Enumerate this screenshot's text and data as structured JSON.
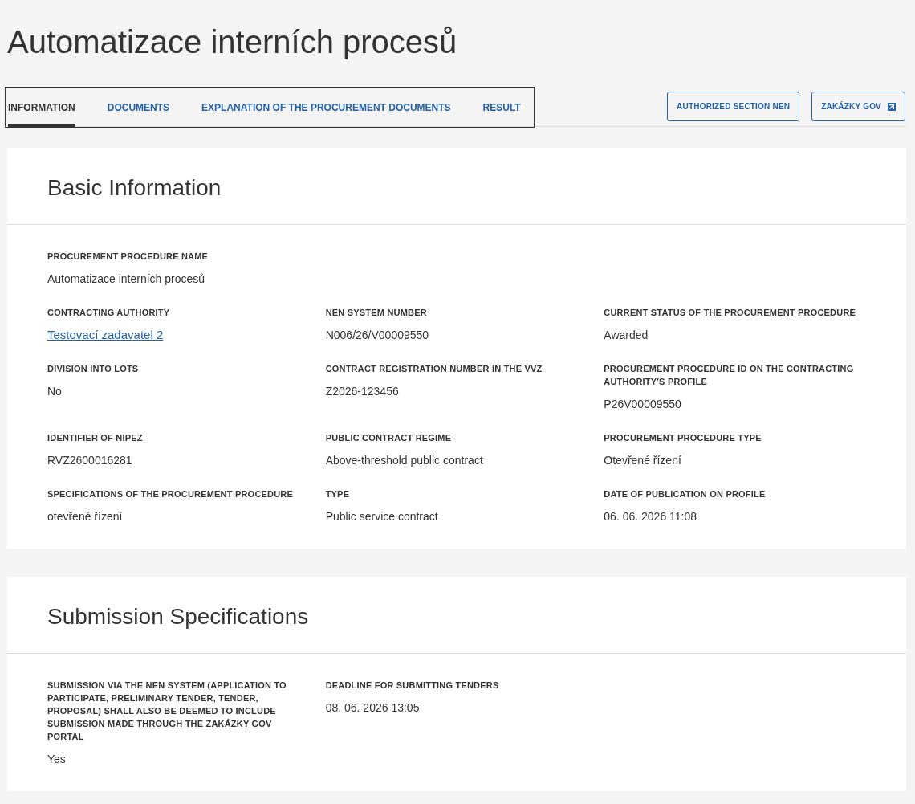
{
  "page_title": "Automatizace interních procesů",
  "tab_bar": {
    "focused": true,
    "tabs": [
      {
        "label": "INFORMATION",
        "selected": true
      },
      {
        "label": "DOCUMENTS",
        "selected": false
      },
      {
        "label": "EXPLANATION OF THE PROCUREMENT DOCUMENTS",
        "selected": false
      },
      {
        "label": "RESULT",
        "selected": false
      }
    ]
  },
  "actions": [
    {
      "label": "AUTHORIZED SECTION NEN",
      "external": false
    },
    {
      "label": "ZAKÁZKY GOV",
      "external": true
    }
  ],
  "sections": [
    {
      "title": "Basic Information",
      "rows": [
        [
          {
            "label": "PROCUREMENT PROCEDURE NAME",
            "value": "Automatizace interních procesů",
            "kind": "text"
          }
        ],
        [
          {
            "label": "CONTRACTING AUTHORITY",
            "value": "Testovací zadavatel 2",
            "kind": "link"
          },
          {
            "label": "NEN SYSTEM NUMBER",
            "value": "N006/26/V00009550",
            "kind": "text"
          },
          {
            "label": "CURRENT STATUS OF THE PROCUREMENT PROCEDURE",
            "value": "Awarded",
            "kind": "text"
          }
        ],
        [
          {
            "label": "DIVISION INTO LOTS",
            "value": "No",
            "kind": "text"
          },
          {
            "label": "CONTRACT REGISTRATION NUMBER IN THE VVZ",
            "value": "Z2026-123456",
            "kind": "text"
          },
          {
            "label": "PROCUREMENT PROCEDURE ID ON THE CONTRACTING AUTHORITY'S PROFILE",
            "value": "P26V00009550",
            "kind": "text"
          }
        ],
        [
          {
            "label": "IDENTIFIER OF NIPEZ",
            "value": "RVZ2600016281",
            "kind": "text"
          },
          {
            "label": "PUBLIC CONTRACT REGIME",
            "value": "Above-threshold public contract",
            "kind": "text"
          },
          {
            "label": "PROCUREMENT PROCEDURE TYPE",
            "value": "Otevřené řízení",
            "kind": "text"
          }
        ],
        [
          {
            "label": "SPECIFICATIONS OF THE PROCUREMENT PROCEDURE",
            "value": "otevřené řízení",
            "kind": "text"
          },
          {
            "label": "TYPE",
            "value": "Public service contract",
            "kind": "text"
          },
          {
            "label": "DATE OF PUBLICATION ON PROFILE",
            "value": "06. 06. 2026 11:08",
            "kind": "text"
          }
        ]
      ]
    },
    {
      "title": "Submission Specifications",
      "rows": [
        [
          {
            "label": "SUBMISSION VIA THE NEN SYSTEM (APPLICATION TO PARTICIPATE, PRELIMINARY TENDER, TENDER, PROPOSAL) SHALL ALSO BE DEEMED TO INCLUDE SUBMISSION MADE THROUGH THE ZAKÁZKY GOV PORTAL",
            "value": "Yes",
            "kind": "text"
          },
          {
            "label": "DEADLINE FOR SUBMITTING TENDERS",
            "value": "08. 06. 2026 13:05",
            "kind": "text"
          }
        ]
      ]
    }
  ]
}
